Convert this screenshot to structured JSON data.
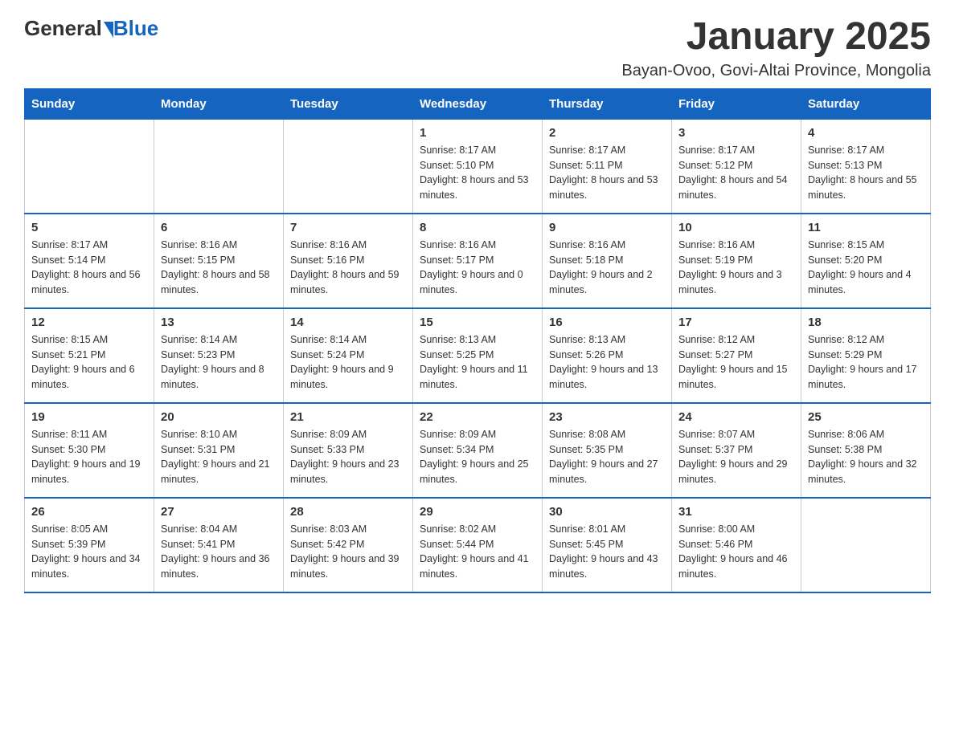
{
  "logo": {
    "general": "General",
    "triangle": "▶",
    "blue": "Blue"
  },
  "title": "January 2025",
  "subtitle": "Bayan-Ovoo, Govi-Altai Province, Mongolia",
  "days_of_week": [
    "Sunday",
    "Monday",
    "Tuesday",
    "Wednesday",
    "Thursday",
    "Friday",
    "Saturday"
  ],
  "weeks": [
    [
      {
        "day": "",
        "info": ""
      },
      {
        "day": "",
        "info": ""
      },
      {
        "day": "",
        "info": ""
      },
      {
        "day": "1",
        "info": "Sunrise: 8:17 AM\nSunset: 5:10 PM\nDaylight: 8 hours and 53 minutes."
      },
      {
        "day": "2",
        "info": "Sunrise: 8:17 AM\nSunset: 5:11 PM\nDaylight: 8 hours and 53 minutes."
      },
      {
        "day": "3",
        "info": "Sunrise: 8:17 AM\nSunset: 5:12 PM\nDaylight: 8 hours and 54 minutes."
      },
      {
        "day": "4",
        "info": "Sunrise: 8:17 AM\nSunset: 5:13 PM\nDaylight: 8 hours and 55 minutes."
      }
    ],
    [
      {
        "day": "5",
        "info": "Sunrise: 8:17 AM\nSunset: 5:14 PM\nDaylight: 8 hours and 56 minutes."
      },
      {
        "day": "6",
        "info": "Sunrise: 8:16 AM\nSunset: 5:15 PM\nDaylight: 8 hours and 58 minutes."
      },
      {
        "day": "7",
        "info": "Sunrise: 8:16 AM\nSunset: 5:16 PM\nDaylight: 8 hours and 59 minutes."
      },
      {
        "day": "8",
        "info": "Sunrise: 8:16 AM\nSunset: 5:17 PM\nDaylight: 9 hours and 0 minutes."
      },
      {
        "day": "9",
        "info": "Sunrise: 8:16 AM\nSunset: 5:18 PM\nDaylight: 9 hours and 2 minutes."
      },
      {
        "day": "10",
        "info": "Sunrise: 8:16 AM\nSunset: 5:19 PM\nDaylight: 9 hours and 3 minutes."
      },
      {
        "day": "11",
        "info": "Sunrise: 8:15 AM\nSunset: 5:20 PM\nDaylight: 9 hours and 4 minutes."
      }
    ],
    [
      {
        "day": "12",
        "info": "Sunrise: 8:15 AM\nSunset: 5:21 PM\nDaylight: 9 hours and 6 minutes."
      },
      {
        "day": "13",
        "info": "Sunrise: 8:14 AM\nSunset: 5:23 PM\nDaylight: 9 hours and 8 minutes."
      },
      {
        "day": "14",
        "info": "Sunrise: 8:14 AM\nSunset: 5:24 PM\nDaylight: 9 hours and 9 minutes."
      },
      {
        "day": "15",
        "info": "Sunrise: 8:13 AM\nSunset: 5:25 PM\nDaylight: 9 hours and 11 minutes."
      },
      {
        "day": "16",
        "info": "Sunrise: 8:13 AM\nSunset: 5:26 PM\nDaylight: 9 hours and 13 minutes."
      },
      {
        "day": "17",
        "info": "Sunrise: 8:12 AM\nSunset: 5:27 PM\nDaylight: 9 hours and 15 minutes."
      },
      {
        "day": "18",
        "info": "Sunrise: 8:12 AM\nSunset: 5:29 PM\nDaylight: 9 hours and 17 minutes."
      }
    ],
    [
      {
        "day": "19",
        "info": "Sunrise: 8:11 AM\nSunset: 5:30 PM\nDaylight: 9 hours and 19 minutes."
      },
      {
        "day": "20",
        "info": "Sunrise: 8:10 AM\nSunset: 5:31 PM\nDaylight: 9 hours and 21 minutes."
      },
      {
        "day": "21",
        "info": "Sunrise: 8:09 AM\nSunset: 5:33 PM\nDaylight: 9 hours and 23 minutes."
      },
      {
        "day": "22",
        "info": "Sunrise: 8:09 AM\nSunset: 5:34 PM\nDaylight: 9 hours and 25 minutes."
      },
      {
        "day": "23",
        "info": "Sunrise: 8:08 AM\nSunset: 5:35 PM\nDaylight: 9 hours and 27 minutes."
      },
      {
        "day": "24",
        "info": "Sunrise: 8:07 AM\nSunset: 5:37 PM\nDaylight: 9 hours and 29 minutes."
      },
      {
        "day": "25",
        "info": "Sunrise: 8:06 AM\nSunset: 5:38 PM\nDaylight: 9 hours and 32 minutes."
      }
    ],
    [
      {
        "day": "26",
        "info": "Sunrise: 8:05 AM\nSunset: 5:39 PM\nDaylight: 9 hours and 34 minutes."
      },
      {
        "day": "27",
        "info": "Sunrise: 8:04 AM\nSunset: 5:41 PM\nDaylight: 9 hours and 36 minutes."
      },
      {
        "day": "28",
        "info": "Sunrise: 8:03 AM\nSunset: 5:42 PM\nDaylight: 9 hours and 39 minutes."
      },
      {
        "day": "29",
        "info": "Sunrise: 8:02 AM\nSunset: 5:44 PM\nDaylight: 9 hours and 41 minutes."
      },
      {
        "day": "30",
        "info": "Sunrise: 8:01 AM\nSunset: 5:45 PM\nDaylight: 9 hours and 43 minutes."
      },
      {
        "day": "31",
        "info": "Sunrise: 8:00 AM\nSunset: 5:46 PM\nDaylight: 9 hours and 46 minutes."
      },
      {
        "day": "",
        "info": ""
      }
    ]
  ]
}
